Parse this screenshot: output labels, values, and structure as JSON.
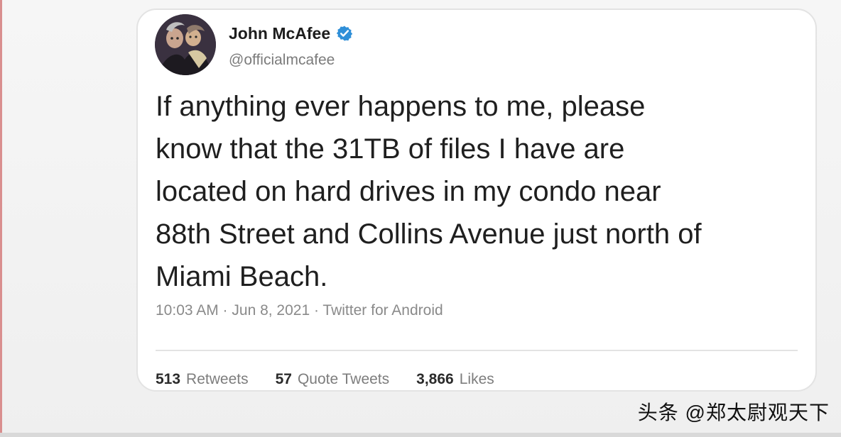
{
  "tweet": {
    "name": "John McAfee",
    "handle": "@officialmcafee",
    "text": "If anything ever happens to me, please\nknow that the 31TB of files I have are\nlocated on hard drives in my condo near\n88th Street and Collins Avenue just north of\nMiami Beach.",
    "meta": "10:03 AM · Jun 8, 2021 · Twitter for Android",
    "stats": [
      {
        "count": "513",
        "label": "Retweets"
      },
      {
        "count": "57",
        "label": "Quote Tweets"
      },
      {
        "count": "3,866",
        "label": "Likes"
      }
    ]
  },
  "watermark": "头条 @郑太尉观天下",
  "icons": {
    "verified": "verified-badge-icon",
    "avatar": "profile-avatar"
  },
  "colors": {
    "card_bg": "#ffffff",
    "text": "#1f1f1f",
    "muted": "#7b7b7b",
    "verified_blue": "#2f8fd8"
  }
}
